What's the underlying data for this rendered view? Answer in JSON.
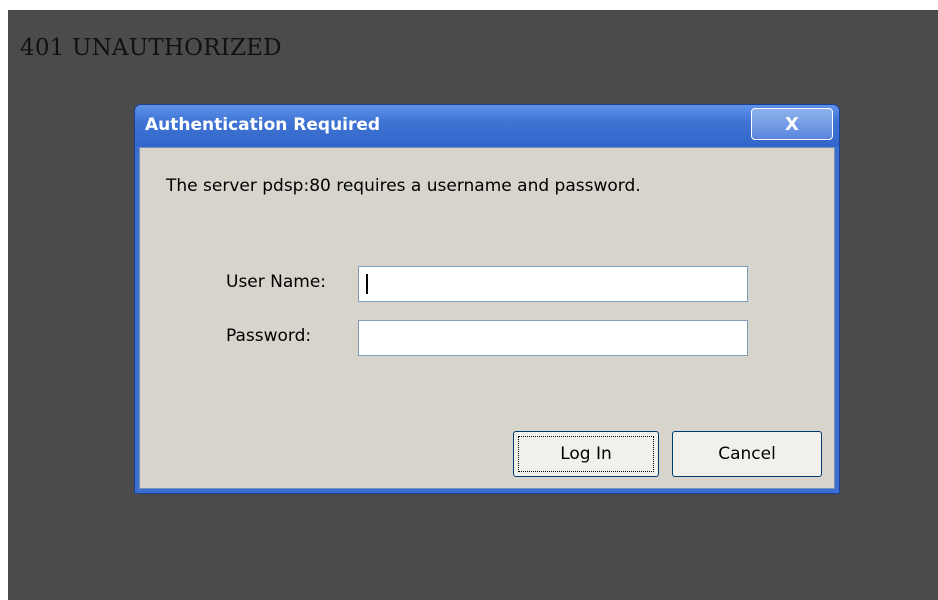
{
  "page": {
    "heading": "401 UNAUTHORIZED"
  },
  "dialog": {
    "title": "Authentication Required",
    "close_glyph": "X",
    "message": "The server pdsp:80 requires a username and password.",
    "fields": {
      "username_label": "User Name:",
      "username_value": "",
      "password_label": "Password:",
      "password_value": ""
    },
    "buttons": {
      "login_label": "Log In",
      "cancel_label": "Cancel"
    }
  },
  "colors": {
    "page_background": "#4b4b4b",
    "titlebar_blue": "#3f74d4",
    "dialog_face": "#d7d4cc"
  }
}
